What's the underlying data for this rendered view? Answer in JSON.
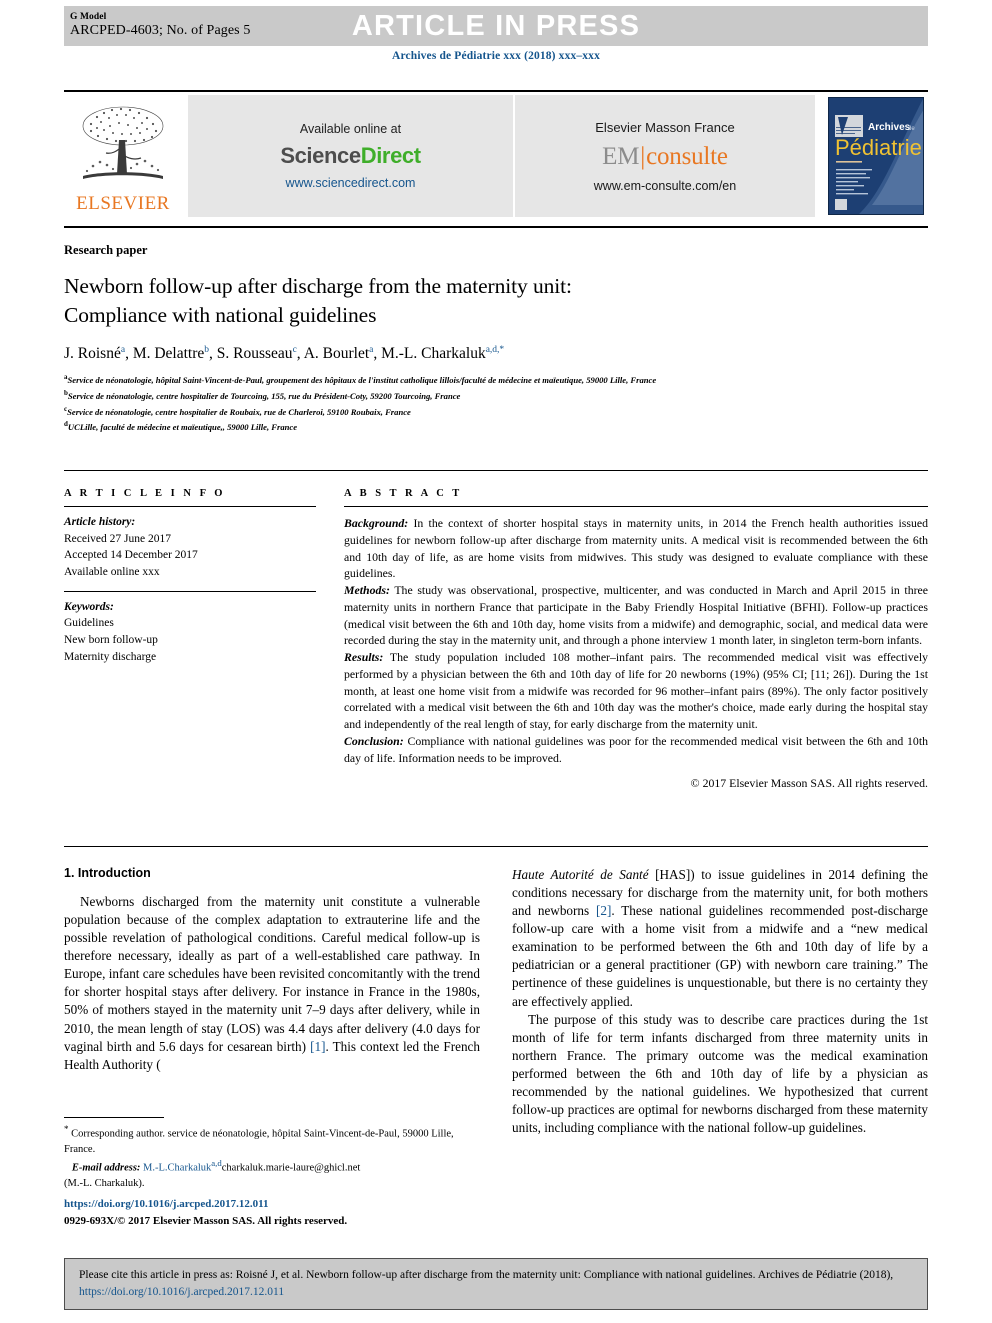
{
  "header": {
    "g_model_label": "G Model",
    "article_id": "ARCPED-4603; No. of Pages 5",
    "article_in_press": "ARTICLE IN PRESS",
    "journal_line": "Archives de Pédiatrie xxx (2018) xxx–xxx"
  },
  "masthead": {
    "elsevier_wordmark": "ELSEVIER",
    "available_online_at": "Available online at",
    "sciencedirect_part1": "Science",
    "sciencedirect_part2": "Direct",
    "sciencedirect_url": "www.sciencedirect.com",
    "em_publisher": "Elsevier Masson France",
    "em_logo_left": "EM",
    "em_logo_bar": "|",
    "em_logo_right": "consulte",
    "em_url": "www.em-consulte.com/en",
    "cover_title_small": "Archives de",
    "cover_title_large": "Pédiatrie"
  },
  "article": {
    "doctype": "Research paper",
    "title_line1": "Newborn follow-up after discharge from the maternity unit:",
    "title_line2": "Compliance with national guidelines",
    "authors": [
      {
        "name": "J. Roisné",
        "sup": "a"
      },
      {
        "name": "M. Delattre",
        "sup": "b"
      },
      {
        "name": "S. Rousseau",
        "sup": "c"
      },
      {
        "name": "A. Bourlet",
        "sup": "a"
      },
      {
        "name": "M.-L. Charkaluk",
        "sup": "a,d,*"
      }
    ],
    "affiliations": [
      {
        "marker": "a",
        "text": "Service de néonatologie, hôpital Saint-Vincent-de-Paul, groupement des hôpitaux de l'institut catholique lillois/faculté de médecine et maïeutique, 59000 Lille, France"
      },
      {
        "marker": "b",
        "text": "Service de néonatologie, centre hospitalier de Tourcoing, 155, rue du Président-Coty, 59200 Tourcoing, France"
      },
      {
        "marker": "c",
        "text": "Service de néonatologie, centre hospitalier de Roubaix, rue de Charleroi, 59100 Roubaix, France"
      },
      {
        "marker": "d",
        "text": "UCLille, faculté de médecine et maïeutique,, 59000 Lille, France"
      }
    ]
  },
  "article_info": {
    "heading": "A R T I C L E   I N F O",
    "history_label": "Article history:",
    "history": [
      "Received 27 June 2017",
      "Accepted 14 December 2017",
      "Available online xxx"
    ],
    "keywords_label": "Keywords:",
    "keywords": [
      "Guidelines",
      "New born follow-up",
      "Maternity discharge"
    ]
  },
  "abstract": {
    "heading": "A B S T R A C T",
    "background_label": "Background:",
    "background_text": " In the context of shorter hospital stays in maternity units, in 2014 the French health authorities issued guidelines for newborn follow-up after discharge from maternity units. A medical visit is recommended between the 6th and 10th day of life, as are home visits from midwives. This study was designed to evaluate compliance with these guidelines.",
    "methods_label": "Methods:",
    "methods_text": " The study was observational, prospective, multicenter, and was conducted in March and April 2015 in three maternity units in northern France that participate in the Baby Friendly Hospital Initiative (BFHI). Follow-up practices (medical visit between the 6th and 10th day, home visits from a midwife) and demographic, social, and medical data were recorded during the stay in the maternity unit, and through a phone interview 1 month later, in singleton term-born infants.",
    "results_label": "Results:",
    "results_text": " The study population included 108 mother–infant pairs. The recommended medical visit was effectively performed by a physician between the 6th and 10th day of life for 20 newborns (19%) (95% CI; [11; 26]). During the 1st month, at least one home visit from a midwife was recorded for 96 mother–infant pairs (89%). The only factor positively correlated with a medical visit between the 6th and 10th day was the mother's choice, made early during the hospital stay and independently of the real length of stay, for early discharge from the maternity unit.",
    "conclusion_label": "Conclusion:",
    "conclusion_text": " Compliance with national guidelines was poor for the recommended medical visit between the 6th and 10th day of life. Information needs to be improved.",
    "copyright": "© 2017 Elsevier Masson SAS. All rights reserved."
  },
  "introduction": {
    "heading": "1. Introduction",
    "para1_a": "Newborns discharged from the maternity unit constitute a vulnerable population because of the complex adaptation to extrauterine life and the possible revelation of pathological conditions. Careful medical follow-up is therefore necessary, ideally as part of a well-established care pathway. In Europe, infant care schedules have been revisited concomitantly with the trend for shorter hospital stays after delivery. For instance in France in the 1980s, 50% of mothers stayed in the maternity unit 7–9 days after delivery, while in 2010, the mean length of stay (LOS) was 4.4 days after delivery (4.0 days for vaginal birth and 5.6 days for cesarean birth) ",
    "para1_ref1": "[1]",
    "para1_b": ". This context led the French Health Authority (",
    "para1_italic": "Haute Autorité de Santé",
    "para1_c": " [HAS]) to issue guidelines in 2014 defining the conditions necessary for discharge from the maternity unit, for both mothers and newborns ",
    "para1_ref2": "[2]",
    "para1_d": ". These national guidelines recommended post-discharge follow-up care with a home visit from a midwife and a “new medical examination to be performed between the 6th and 10th day of life by a pediatrician or a general practitioner (GP) with newborn care training.” The pertinence of these guidelines is unquestionable, but there is no certainty they are effectively applied.",
    "para2": "The purpose of this study was to describe care practices during the 1st month of life for term infants discharged from three maternity units in northern France. The primary outcome was the medical examination performed between the 6th and 10th day of life by a physician as recommended by the national guidelines. We hypothesized that current follow-up practices are optimal for newborns discharged from these maternity units, including compliance with the national follow-up guidelines."
  },
  "footnotes": {
    "corresponding_marker": "*",
    "corresponding_text": " Corresponding author. service de néonatologie, hôpital Saint-Vincent-de-Paul, 59000 Lille, France.",
    "email_label": "E-mail address:",
    "email_link": "M.-L.Charkaluk",
    "email_sup": "a,d",
    "email_rest": "charkaluk.marie-laure@ghicl.net",
    "email_owner": "(M.-L. Charkaluk).",
    "doi": "https://doi.org/10.1016/j.arcped.2017.12.011",
    "issn_copyright": "0929-693X/© 2017 Elsevier Masson SAS. All rights reserved."
  },
  "cite_box": {
    "text": "Please cite this article in press as: Roisné J, et al. Newborn follow-up after discharge from the maternity unit: Compliance with national guidelines. Archives de Pédiatrie (2018), ",
    "link": "https://doi.org/10.1016/j.arcped.2017.12.011"
  },
  "colors": {
    "link_blue": "#15558d",
    "elsevier_orange": "#E87722",
    "sciencedirect_green": "#3fae2a",
    "banner_gray": "#c9c9c9",
    "panel_gray": "#e6e6e6"
  }
}
